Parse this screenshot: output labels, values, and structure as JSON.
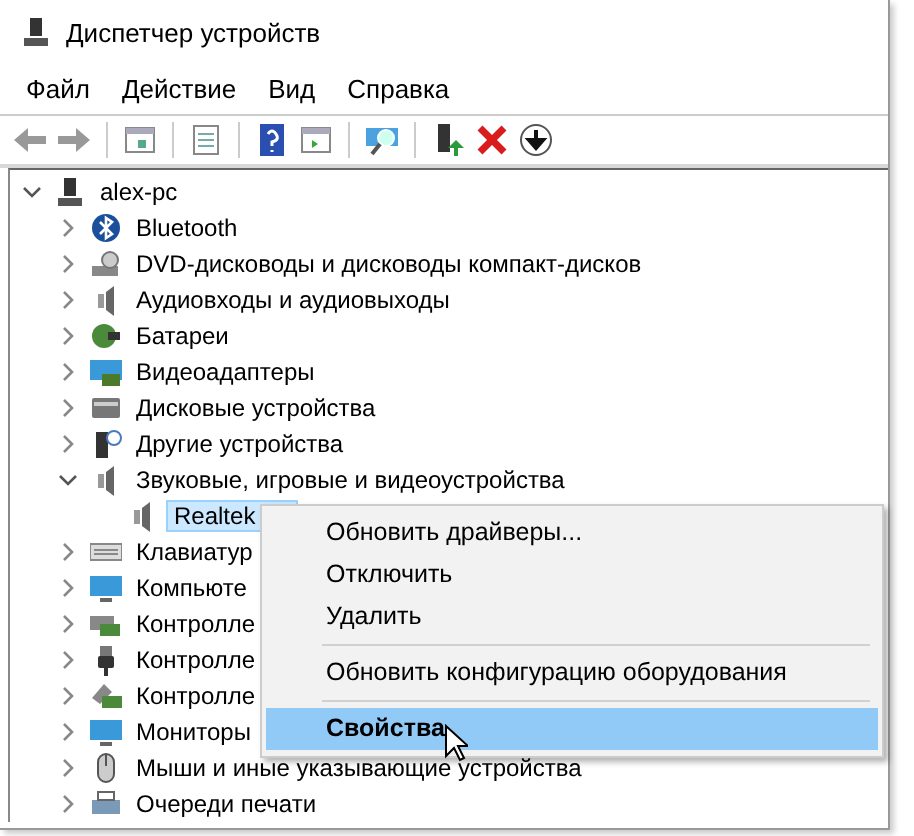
{
  "window": {
    "title": "Диспетчер устройств"
  },
  "menu": [
    "Файл",
    "Действие",
    "Вид",
    "Справка"
  ],
  "toolbar": [
    {
      "kind": "back"
    },
    {
      "kind": "forward"
    },
    {
      "kind": "separator"
    },
    {
      "kind": "panel"
    },
    {
      "kind": "separator"
    },
    {
      "kind": "properties"
    },
    {
      "kind": "separator"
    },
    {
      "kind": "help"
    },
    {
      "kind": "panel2"
    },
    {
      "kind": "separator"
    },
    {
      "kind": "scan"
    },
    {
      "kind": "separator"
    },
    {
      "kind": "add"
    },
    {
      "kind": "remove"
    },
    {
      "kind": "download"
    }
  ],
  "tree": {
    "label": "alex-pc",
    "kind": "computer",
    "expanded": true,
    "selected": false,
    "children": [
      {
        "label": "Bluetooth",
        "kind": "bluetooth",
        "expanded": false,
        "selected": false
      },
      {
        "label": "DVD-дисководы и дисководы компакт-дисков",
        "kind": "disc",
        "expanded": false,
        "selected": false
      },
      {
        "label": "Аудиовходы и аудиовыходы",
        "kind": "speaker",
        "expanded": false,
        "selected": false
      },
      {
        "label": "Батареи",
        "kind": "battery",
        "expanded": false,
        "selected": false
      },
      {
        "label": "Видеоадаптеры",
        "kind": "display",
        "expanded": false,
        "selected": false
      },
      {
        "label": "Дисковые устройства",
        "kind": "drive",
        "expanded": false,
        "selected": false
      },
      {
        "label": "Другие устройства",
        "kind": "unknown",
        "expanded": false,
        "selected": false
      },
      {
        "label": "Звуковые, игровые и видеоустройства",
        "kind": "speaker",
        "expanded": true,
        "selected": false,
        "children": [
          {
            "label": "Realtek",
            "kind": "speaker",
            "selected": true
          }
        ]
      },
      {
        "label": "Клавиатур",
        "kind": "keyboard",
        "expanded": false,
        "selected": false
      },
      {
        "label": "Компьюте",
        "kind": "monitor",
        "expanded": false,
        "selected": false
      },
      {
        "label": "Контролле",
        "kind": "card",
        "expanded": false,
        "selected": false
      },
      {
        "label": "Контролле",
        "kind": "usb",
        "expanded": false,
        "selected": false
      },
      {
        "label": "Контролле",
        "kind": "storage",
        "expanded": false,
        "selected": false
      },
      {
        "label": "Мониторы",
        "kind": "monitor",
        "expanded": false,
        "selected": false
      },
      {
        "label": "Мыши и иные указывающие устройства",
        "kind": "mouse",
        "expanded": false,
        "selected": false
      },
      {
        "label": "Очереди печати",
        "kind": "printer",
        "expanded": false,
        "selected": false
      }
    ]
  },
  "context_menu": [
    {
      "kind": "item",
      "label": "Обновить драйверы...",
      "selected": false
    },
    {
      "kind": "item",
      "label": "Отключить",
      "selected": false
    },
    {
      "kind": "item",
      "label": "Удалить",
      "selected": false
    },
    {
      "kind": "separator"
    },
    {
      "kind": "item",
      "label": "Обновить конфигурацию оборудования",
      "selected": false
    },
    {
      "kind": "separator"
    },
    {
      "kind": "item",
      "label": "Свойства",
      "selected": true
    }
  ]
}
